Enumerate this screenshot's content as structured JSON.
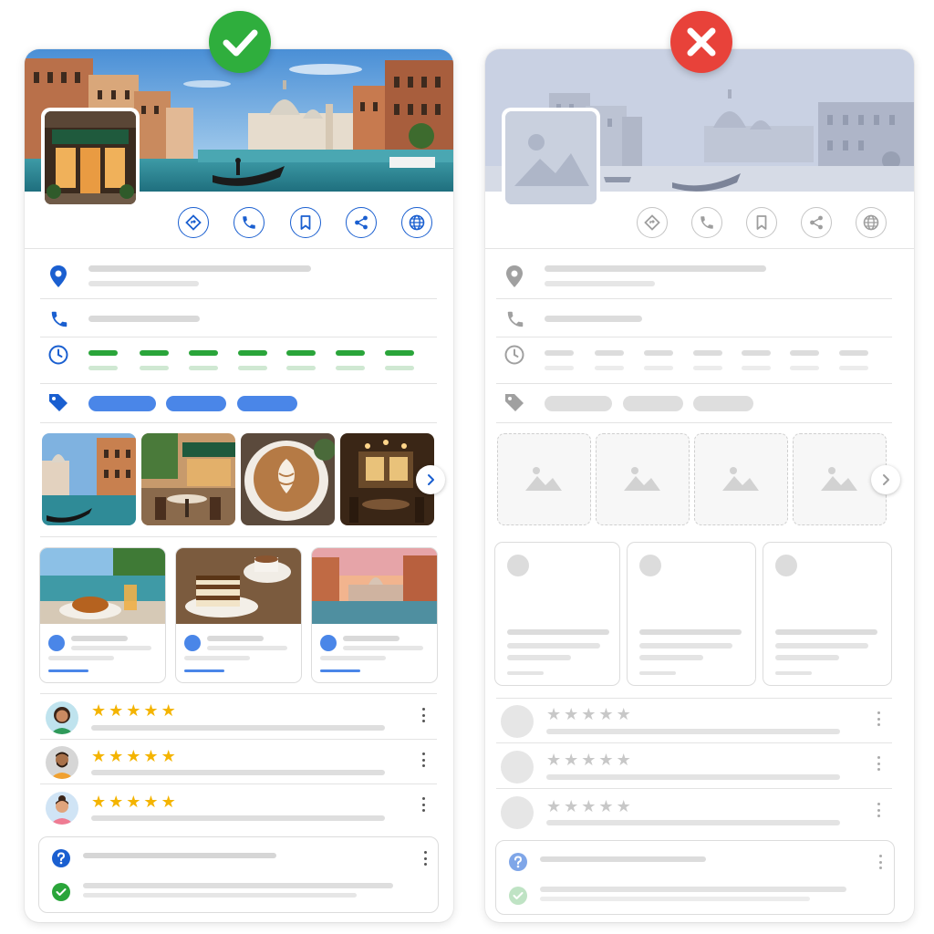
{
  "comparison": {
    "good": {
      "badge_icon": "check-icon",
      "badge_color": "#2fae3d",
      "accent": "#1a5fd0",
      "hours_color": "#2aa53a",
      "star_color": "#f4b400"
    },
    "bad": {
      "badge_icon": "close-icon",
      "badge_color": "#e8423a",
      "accent": "#bdbdbd",
      "star_color": "#c8c8c8"
    }
  },
  "action_icons": [
    "directions-icon",
    "phone-icon",
    "bookmark-icon",
    "share-icon",
    "globe-icon"
  ],
  "info_icons": [
    "location-pin-icon",
    "phone-icon",
    "clock-icon",
    "tag-icon"
  ],
  "photos": [
    "venice-canal-photo",
    "cafe-terrace-photo",
    "latte-art-photo",
    "restaurant-interior-photo"
  ],
  "posts": [
    "canal-dinner-post",
    "tiramisu-coffee-post",
    "venice-sunset-post"
  ],
  "reviews": [
    {
      "stars": 5,
      "avatar": "woman-avatar"
    },
    {
      "stars": 5,
      "avatar": "bearded-man-avatar"
    },
    {
      "stars": 5,
      "avatar": "woman-bun-avatar"
    }
  ],
  "qa_icons": [
    "question-icon",
    "answer-check-icon"
  ]
}
